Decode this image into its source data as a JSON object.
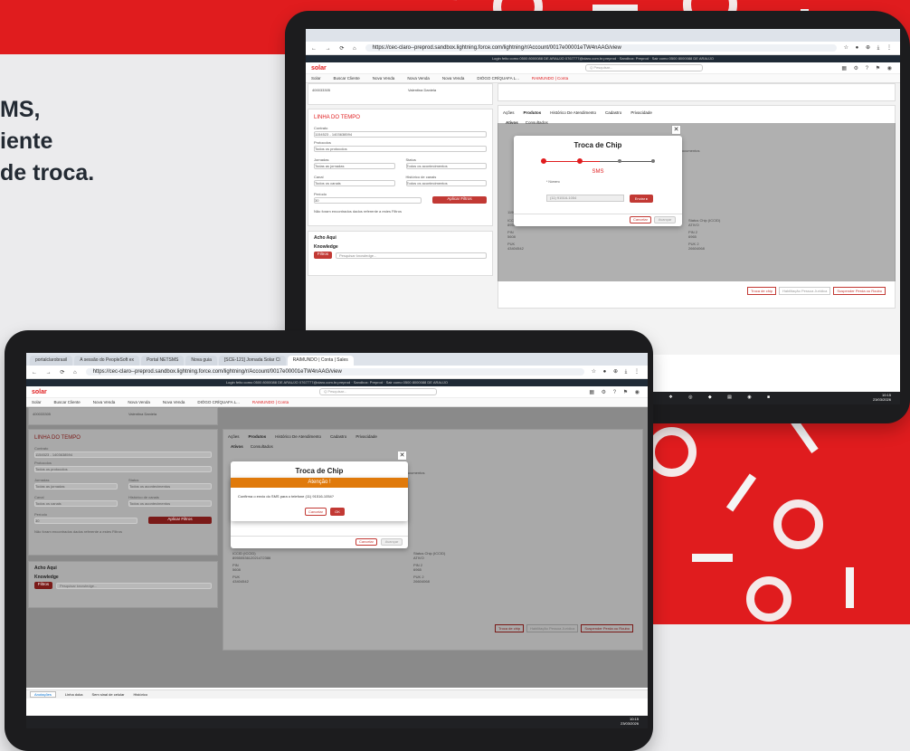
{
  "headline": {
    "line1": "MS,",
    "line2": "iente",
    "line3": "de troca."
  },
  "browser": {
    "url": "https://cec-claro--preprod.sandbox.lightning.force.com/lightning/r/Account/0017e00001eTW4nAAG/view",
    "tabs": [
      "portalclarobrasil",
      "A sessão do PeopleSoft ex",
      "Portal NETSMS",
      "Nova guia",
      "[SCE-121] Jornada Solar Cl",
      "RAIMUNDO | Conta | Sales"
    ],
    "sandbox_banner": "Login feito como 0500 8000088 DE ARAUJO 0767777@claro.com.br.preprod · Sandbox: Preprod · Sair como 0500 8000088 DE ARAUJO"
  },
  "app": {
    "logo": "solar",
    "search_placeholder": "Q Pesquisar...",
    "nav": [
      "Solar",
      "Buscar Cliente",
      "Nova Venda",
      "Nova Venda",
      "Nova Venda",
      "DIÓGO CRÍQUAFA L...",
      "RAIMUNDO | Conta"
    ],
    "contract": "400033305",
    "customer": "Valentina Daniela"
  },
  "timeline": {
    "title": "LINHA DO TEMPO",
    "fields": [
      {
        "label": "Contrato",
        "value": "1154523 - 1403638594"
      },
      {
        "label": "Protocolos",
        "value": "Todos os protocolos"
      },
      {
        "label": "Jornadas",
        "value": "Todas as jornadas"
      },
      {
        "label": "Status",
        "value": "Todos os acontecimentos"
      },
      {
        "label": "Canal",
        "value": "Todos os canais"
      },
      {
        "label": "Histórico de canais",
        "value": "Todos os acontecimentos"
      },
      {
        "label": "Período",
        "value": "30"
      }
    ],
    "apply": "Aplicar Filtros",
    "empty": "Não foram encontrados dados referente a estes Filtros"
  },
  "knowledge": {
    "section": "Acho Aqui",
    "title": "Knowledge",
    "button": "Filtros",
    "placeholder": "Pesquisar knowledge..."
  },
  "tabs": [
    "Ações",
    "Produtos",
    "Histórico De Atendimento",
    "Cadastro",
    "Privacidade"
  ],
  "subtabs": [
    "Ativos",
    "Consultados"
  ],
  "products": {
    "col": "Documentos",
    "line": "1199946174",
    "iccid_label": "ICCID (ICCID)",
    "iccid": "8955053612021472386",
    "status_label": "Status Chip (ICCID)",
    "status": "ATIVO",
    "pin_label": "PIN",
    "pin": "5608",
    "pin2_label": "PIN 2",
    "pin2": "6965",
    "puk_label": "PUK",
    "puk": "43404542",
    "puk2_label": "PUK 2",
    "puk2": "26604068",
    "actions": [
      "Troca de chip",
      "Habilitação Pessoa Jurídica",
      "Suspender Perda ou Roubo"
    ]
  },
  "modal1": {
    "title": "Troca de Chip",
    "step": "SMS",
    "number_label": "* Número",
    "number": "(11) 91516-1054",
    "send": "Enviar",
    "cancel": "Cancelar",
    "next": "Avançar"
  },
  "modal2": {
    "title": "Troca de Chip",
    "alert_title": "Atenção !",
    "message": "Confirma o envio do SMS para o telefone (11) 91516-1054?",
    "cancel": "Cancelar",
    "ok": "OK",
    "footer_cancel": "Cancelar",
    "footer_next": "Avançar"
  },
  "utility": {
    "items": [
      "Anotações",
      "Linha doka",
      "Sem sinal de celular",
      "Histórico"
    ]
  },
  "taskbar": {
    "time": "10:15",
    "date": "23/03/2026"
  },
  "colors": {
    "brand_red": "#e01c1e",
    "alert_orange": "#e07a0b",
    "button_red": "#c23934"
  }
}
